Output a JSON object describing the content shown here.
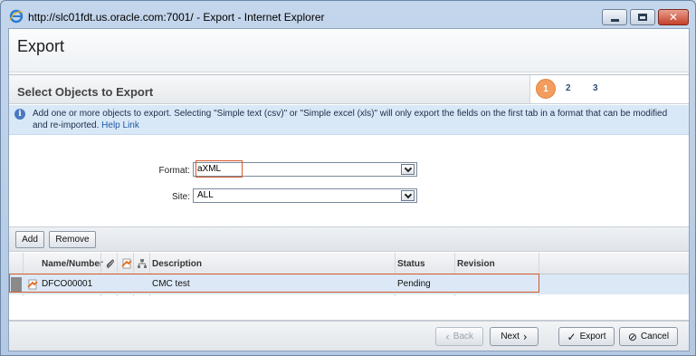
{
  "window": {
    "title": "http://slc01fdt.us.oracle.com:7001/ - Export - Internet Explorer",
    "icon": "internet-explorer-icon"
  },
  "page": {
    "title": "Export"
  },
  "section": {
    "title": "Select Objects to Export",
    "steps": [
      "1",
      "2",
      "3"
    ],
    "active_step": "1"
  },
  "info": {
    "text": "Add one or more objects to export. Selecting \"Simple text (csv)\" or \"Simple excel (xls)\" will only export the fields on the first tab in a format that can be modified and re-imported.",
    "link": "Help Link"
  },
  "form": {
    "format_label": "Format:",
    "format_value": "aXML",
    "site_label": "Site:",
    "site_value": "ALL"
  },
  "toolbar": {
    "add_label": "Add",
    "remove_label": "Remove"
  },
  "table": {
    "columns": [
      "Name/Number",
      "Description",
      "Status",
      "Revision"
    ],
    "rows": [
      {
        "name": "DFCO00001",
        "description": "CMC test",
        "status": "Pending",
        "revision": ""
      }
    ]
  },
  "footer": {
    "back_label": "Back",
    "next_label": "Next",
    "export_label": "Export",
    "cancel_label": "Cancel"
  },
  "colors": {
    "accent_orange": "#f29d5f",
    "focus_outline": "#d45a2a",
    "info_bg": "#d9e8f7",
    "row_selected": "#dce8f6"
  }
}
